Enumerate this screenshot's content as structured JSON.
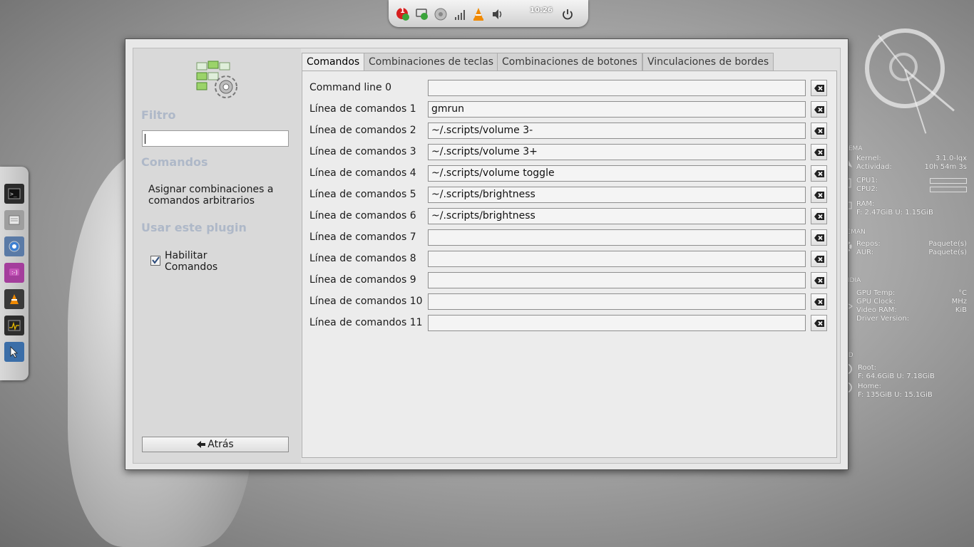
{
  "panel": {
    "clock": "10:26",
    "notification_count": "1"
  },
  "window": {
    "sidebar": {
      "filter_heading": "Filtro",
      "filter_value": "",
      "commands_heading": "Comandos",
      "description": "Asignar combinaciones a comandos arbitrarios",
      "use_plugin_heading": "Usar este plugin",
      "enable_label": "Habilitar Comandos",
      "enable_checked": true,
      "back_label": "Atrás"
    },
    "tabs": [
      {
        "label": "Comandos",
        "active": true
      },
      {
        "label": "Combinaciones de teclas",
        "active": false
      },
      {
        "label": "Combinaciones de botones",
        "active": false
      },
      {
        "label": "Vinculaciones de bordes",
        "active": false
      }
    ],
    "commands": [
      {
        "label": "Command line 0",
        "value": ""
      },
      {
        "label": "Línea de comandos 1",
        "value": "gmrun"
      },
      {
        "label": "Línea de comandos 2",
        "value": "~/.scripts/volume 3-"
      },
      {
        "label": "Línea de comandos 3",
        "value": "~/.scripts/volume 3+"
      },
      {
        "label": "Línea de comandos 4",
        "value": "~/.scripts/volume toggle"
      },
      {
        "label": "Línea de comandos 5",
        "value": "~/.scripts/brightness"
      },
      {
        "label": "Línea de comandos 6",
        "value": "~/.scripts/brightness"
      },
      {
        "label": "Línea de comandos 7",
        "value": ""
      },
      {
        "label": "Línea de comandos 8",
        "value": ""
      },
      {
        "label": "Línea de comandos 9",
        "value": ""
      },
      {
        "label": "Línea de comandos 10",
        "value": ""
      },
      {
        "label": "Línea de comandos 11",
        "value": ""
      }
    ]
  },
  "conky": {
    "system_heading": "ISTEMA",
    "kernel_label": "Kernel:",
    "kernel_value": "3.1.0-lqx",
    "uptime_label": "Actividad:",
    "uptime_value": "10h 54m 3s",
    "cpu1_label": "CPU1:",
    "cpu2_label": "CPU2:",
    "ram_label": "RAM:",
    "ram_detail": "F: 2.47GiB U: 1.15GiB",
    "pacman_heading": "PACMAN",
    "repos_label": "Repos:",
    "repos_unit": "Paquete(s)",
    "aur_label": "AUR:",
    "aur_unit": "Paquete(s)",
    "nvidia_heading": "NVIDIA",
    "gpu_temp_label": "GPU Temp:",
    "gpu_temp_unit": "°C",
    "gpu_clock_label": "GPU Clock:",
    "gpu_clock_unit": "MHz",
    "video_ram_label": "Video RAM:",
    "video_ram_unit": "KiB",
    "driver_label": "Driver Version:",
    "hdd_heading": "HDD",
    "root_label": "Root:",
    "root_detail": "F: 64.6GiB U: 7.18GiB",
    "home_label": "Home:",
    "home_detail": "F: 135GiB U: 15.1GiB"
  },
  "colors": {
    "accent_blue": "#3ea6e6",
    "heading_gray_blue": "#aeb8c8"
  }
}
